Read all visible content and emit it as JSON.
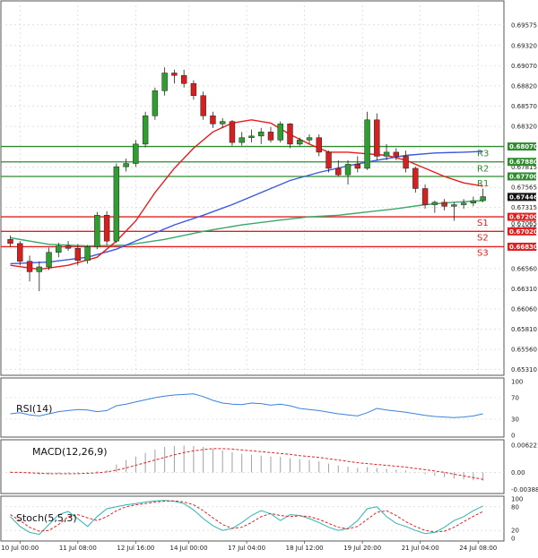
{
  "chart_data": {
    "type": "candlestick",
    "main": {
      "ylim": [
        0.6525,
        0.6985
      ],
      "y_ticks": [
        "0.69575",
        "0.69320",
        "0.69070",
        "0.68820",
        "0.68570",
        "0.68320",
        "0.68070",
        "0.67815",
        "0.67565",
        "0.67315",
        "0.67065",
        "0.66810",
        "0.66560",
        "0.66310",
        "0.66060",
        "0.65810",
        "0.65560",
        "0.65310"
      ],
      "candles": [
        [
          0.6692,
          0.6697,
          0.6683,
          0.6687
        ],
        [
          0.6687,
          0.669,
          0.666,
          0.6665
        ],
        [
          0.6665,
          0.6672,
          0.664,
          0.6652
        ],
        [
          0.6652,
          0.6665,
          0.6628,
          0.6658
        ],
        [
          0.6658,
          0.6682,
          0.6654,
          0.6676
        ],
        [
          0.6676,
          0.6688,
          0.667,
          0.6684
        ],
        [
          0.6684,
          0.669,
          0.6678,
          0.6681
        ],
        [
          0.6681,
          0.6686,
          0.666,
          0.6666
        ],
        [
          0.6666,
          0.6685,
          0.6662,
          0.6683
        ],
        [
          0.6683,
          0.6726,
          0.668,
          0.6722
        ],
        [
          0.6722,
          0.6727,
          0.6685,
          0.669
        ],
        [
          0.669,
          0.6786,
          0.6688,
          0.6782
        ],
        [
          0.6782,
          0.6792,
          0.6776,
          0.6786
        ],
        [
          0.6786,
          0.6815,
          0.6782,
          0.681
        ],
        [
          0.681,
          0.685,
          0.6806,
          0.6845
        ],
        [
          0.6845,
          0.688,
          0.684,
          0.6876
        ],
        [
          0.6876,
          0.6905,
          0.687,
          0.6898
        ],
        [
          0.6898,
          0.6902,
          0.6885,
          0.6895
        ],
        [
          0.6895,
          0.6902,
          0.688,
          0.6885
        ],
        [
          0.6885,
          0.6889,
          0.6865,
          0.687
        ],
        [
          0.687,
          0.6875,
          0.684,
          0.6845
        ],
        [
          0.6845,
          0.685,
          0.683,
          0.6835
        ],
        [
          0.6835,
          0.6842,
          0.683,
          0.6838
        ],
        [
          0.6838,
          0.684,
          0.6808,
          0.6812
        ],
        [
          0.6812,
          0.6825,
          0.6808,
          0.6818
        ],
        [
          0.6818,
          0.6828,
          0.6812,
          0.682
        ],
        [
          0.682,
          0.683,
          0.681,
          0.6825
        ],
        [
          0.6825,
          0.6831,
          0.6812,
          0.6815
        ],
        [
          0.6815,
          0.6838,
          0.6812,
          0.6835
        ],
        [
          0.6835,
          0.6836,
          0.6805,
          0.681
        ],
        [
          0.681,
          0.6818,
          0.6808,
          0.6815
        ],
        [
          0.6815,
          0.6822,
          0.681,
          0.6818
        ],
        [
          0.6818,
          0.6822,
          0.6795,
          0.68
        ],
        [
          0.68,
          0.6802,
          0.6775,
          0.678
        ],
        [
          0.678,
          0.679,
          0.677,
          0.6772
        ],
        [
          0.6772,
          0.679,
          0.676,
          0.6785
        ],
        [
          0.6785,
          0.6795,
          0.6775,
          0.678
        ],
        [
          0.678,
          0.685,
          0.6778,
          0.684
        ],
        [
          0.684,
          0.6848,
          0.679,
          0.6795
        ],
        [
          0.6795,
          0.681,
          0.679,
          0.68
        ],
        [
          0.68,
          0.6805,
          0.679,
          0.6795
        ],
        [
          0.6795,
          0.6802,
          0.6775,
          0.678
        ],
        [
          0.678,
          0.6782,
          0.675,
          0.6755
        ],
        [
          0.6755,
          0.676,
          0.673,
          0.6735
        ],
        [
          0.6735,
          0.674,
          0.6725,
          0.6738
        ],
        [
          0.6738,
          0.6742,
          0.6728,
          0.6733
        ],
        [
          0.6733,
          0.6738,
          0.6715,
          0.6735
        ],
        [
          0.6735,
          0.6742,
          0.673,
          0.6737
        ],
        [
          0.6737,
          0.6745,
          0.6733,
          0.674
        ],
        [
          0.674,
          0.6755,
          0.6738,
          0.6745
        ]
      ],
      "ma_red": [
        [
          0,
          0.666
        ],
        [
          3,
          0.6655
        ],
        [
          6,
          0.666
        ],
        [
          9,
          0.667
        ],
        [
          11,
          0.669
        ],
        [
          13,
          0.6715
        ],
        [
          15,
          0.675
        ],
        [
          17,
          0.678
        ],
        [
          19,
          0.6805
        ],
        [
          21,
          0.6825
        ],
        [
          23,
          0.6836
        ],
        [
          25,
          0.684
        ],
        [
          27,
          0.6836
        ],
        [
          29,
          0.6822
        ],
        [
          31,
          0.681
        ],
        [
          33,
          0.68
        ],
        [
          35,
          0.68
        ],
        [
          37,
          0.6798
        ],
        [
          39,
          0.6796
        ],
        [
          41,
          0.679
        ],
        [
          43,
          0.678
        ],
        [
          45,
          0.677
        ],
        [
          47,
          0.6762
        ],
        [
          49,
          0.6758
        ]
      ],
      "ma_blue": [
        [
          0,
          0.6662
        ],
        [
          4,
          0.6664
        ],
        [
          8,
          0.667
        ],
        [
          11,
          0.668
        ],
        [
          14,
          0.6695
        ],
        [
          17,
          0.671
        ],
        [
          20,
          0.6722
        ],
        [
          23,
          0.6735
        ],
        [
          26,
          0.675
        ],
        [
          29,
          0.6765
        ],
        [
          32,
          0.6775
        ],
        [
          35,
          0.6783
        ],
        [
          38,
          0.679
        ],
        [
          41,
          0.6796
        ],
        [
          44,
          0.6799
        ],
        [
          47,
          0.68
        ],
        [
          49,
          0.6801
        ]
      ],
      "ma_green": [
        [
          0,
          0.6694
        ],
        [
          4,
          0.6686
        ],
        [
          8,
          0.6684
        ],
        [
          12,
          0.6685
        ],
        [
          16,
          0.6692
        ],
        [
          20,
          0.6702
        ],
        [
          24,
          0.671
        ],
        [
          28,
          0.6716
        ],
        [
          31,
          0.672
        ],
        [
          34,
          0.6722
        ],
        [
          37,
          0.6726
        ],
        [
          40,
          0.673
        ],
        [
          43,
          0.6735
        ],
        [
          46,
          0.6738
        ],
        [
          49,
          0.674
        ]
      ],
      "levels": [
        {
          "name": "R3",
          "value": 0.6807,
          "label": "0.68070",
          "color": "#2e8b2e"
        },
        {
          "name": "R2",
          "value": 0.6788,
          "label": "0.67880",
          "color": "#2e8b2e"
        },
        {
          "name": "R1",
          "value": 0.677,
          "label": "0.67700",
          "color": "#2e8b2e"
        },
        {
          "name": "S1",
          "value": 0.672,
          "label": "0.67200",
          "color": "#e02020"
        },
        {
          "name": "S2",
          "value": 0.6702,
          "label": "0.67020",
          "color": "#e02020"
        },
        {
          "name": "S3",
          "value": 0.6683,
          "label": "0.66830",
          "color": "#e02020"
        }
      ],
      "current_price": {
        "value": 0.67446,
        "label": "0.67446"
      }
    },
    "rsi": {
      "title": "RSI(14)",
      "ylim": [
        0,
        100
      ],
      "y_ticks": [
        {
          "v": 100,
          "label": "100"
        },
        {
          "v": 70,
          "label": "70"
        },
        {
          "v": 30,
          "label": "30"
        },
        {
          "v": 0,
          "label": "0"
        }
      ],
      "values": [
        40,
        42,
        38,
        36,
        40,
        44,
        46,
        48,
        47,
        44,
        46,
        55,
        58,
        62,
        66,
        70,
        73,
        75,
        76,
        77,
        72,
        65,
        60,
        58,
        57,
        60,
        59,
        56,
        58,
        55,
        50,
        48,
        46,
        43,
        40,
        38,
        36,
        42,
        50,
        47,
        45,
        43,
        40,
        37,
        35,
        34,
        33,
        34,
        36,
        40
      ]
    },
    "macd": {
      "title": "MACD(12,26,9)",
      "ylim": [
        -0.0042,
        0.0066
      ],
      "y_ticks": [
        {
          "v": 0.006221,
          "label": "0.006221"
        },
        {
          "v": 0,
          "label": "0.00"
        },
        {
          "v": -0.003883,
          "label": "-0.003883"
        }
      ],
      "histogram": [
        0.0002,
        0.0001,
        -0.0003,
        -0.0005,
        -0.0004,
        -0.0003,
        -0.0002,
        -0.0002,
        -0.0001,
        0.0003,
        0.0005,
        0.0018,
        0.0028,
        0.0036,
        0.0044,
        0.0052,
        0.0058,
        0.006,
        0.0061,
        0.006,
        0.0058,
        0.0054,
        0.005,
        0.0046,
        0.0042,
        0.004,
        0.0038,
        0.0036,
        0.0035,
        0.0032,
        0.003,
        0.0028,
        0.0025,
        0.002,
        0.0016,
        0.0013,
        0.001,
        0.0012,
        0.001,
        0.0008,
        0.0006,
        0.0004,
        0.0001,
        -0.0004,
        -0.0008,
        -0.0011,
        -0.0014,
        -0.0016,
        -0.0018,
        -0.0019
      ],
      "signal": [
        0.0,
        0.0,
        -0.0001,
        -0.0002,
        -0.0003,
        -0.0003,
        -0.0003,
        -0.0003,
        -0.0002,
        -0.0001,
        0.0001,
        0.0005,
        0.001,
        0.0016,
        0.0022,
        0.0028,
        0.0034,
        0.004,
        0.0045,
        0.0049,
        0.0052,
        0.0054,
        0.0054,
        0.0053,
        0.0051,
        0.0049,
        0.0047,
        0.0045,
        0.0043,
        0.0041,
        0.0038,
        0.0036,
        0.0034,
        0.0031,
        0.0028,
        0.0025,
        0.0022,
        0.002,
        0.0018,
        0.0016,
        0.0014,
        0.0012,
        0.0009,
        0.0006,
        0.0003,
        0.0,
        -0.0004,
        -0.0008,
        -0.0012,
        -0.0016
      ]
    },
    "stoch": {
      "title": "Stoch(5,5,3)",
      "ylim": [
        0,
        100
      ],
      "y_ticks": [
        {
          "v": 100,
          "label": "100"
        },
        {
          "v": 80,
          "label": "80"
        },
        {
          "v": 20,
          "label": "20"
        },
        {
          "v": 0,
          "label": "0"
        }
      ],
      "k": [
        55,
        30,
        15,
        10,
        35,
        60,
        68,
        50,
        30,
        55,
        75,
        80,
        85,
        88,
        92,
        95,
        96,
        94,
        88,
        72,
        50,
        32,
        20,
        25,
        40,
        58,
        70,
        62,
        45,
        60,
        58,
        50,
        40,
        28,
        20,
        25,
        45,
        75,
        80,
        55,
        38,
        30,
        20,
        12,
        15,
        28,
        45,
        55,
        70,
        82
      ],
      "d": [
        60,
        45,
        28,
        18,
        20,
        35,
        55,
        60,
        52,
        45,
        55,
        70,
        80,
        85,
        88,
        92,
        94,
        95,
        92,
        85,
        70,
        52,
        35,
        25,
        28,
        40,
        55,
        63,
        58,
        55,
        57,
        55,
        48,
        38,
        28,
        24,
        30,
        48,
        66,
        70,
        58,
        42,
        30,
        20,
        16,
        18,
        28,
        42,
        56,
        68
      ]
    },
    "x_ticks": [
      {
        "i": 1,
        "label": "10 Jul 00:00"
      },
      {
        "i": 7,
        "label": "11 Jul 08:00"
      },
      {
        "i": 13,
        "label": "12 Jul 16:00"
      },
      {
        "i": 18.5,
        "label": "14 Jul 00:00"
      },
      {
        "i": 24.5,
        "label": "17 Jul 04:00"
      },
      {
        "i": 30.5,
        "label": "18 Jul 12:00"
      },
      {
        "i": 36.5,
        "label": "19 Jul 20:00"
      },
      {
        "i": 42.5,
        "label": "21 Jul 04:00"
      },
      {
        "i": 48.5,
        "label": "24 Jul 08:00"
      }
    ],
    "extra_price_label": "0.67065",
    "colors": {
      "up": "#2e9e2e",
      "down": "#d42020",
      "ma_red": "#e81b1b",
      "ma_blue": "#3b5bd9",
      "ma_green": "#3aa86b",
      "rsi": "#3b82d9",
      "macd_hist": "#a0a0a0",
      "macd_signal": "#e02020",
      "stoch_k": "#2bb5b5",
      "stoch_d": "#e02020",
      "badge": "#e02020",
      "price_badge": "#111111"
    }
  }
}
